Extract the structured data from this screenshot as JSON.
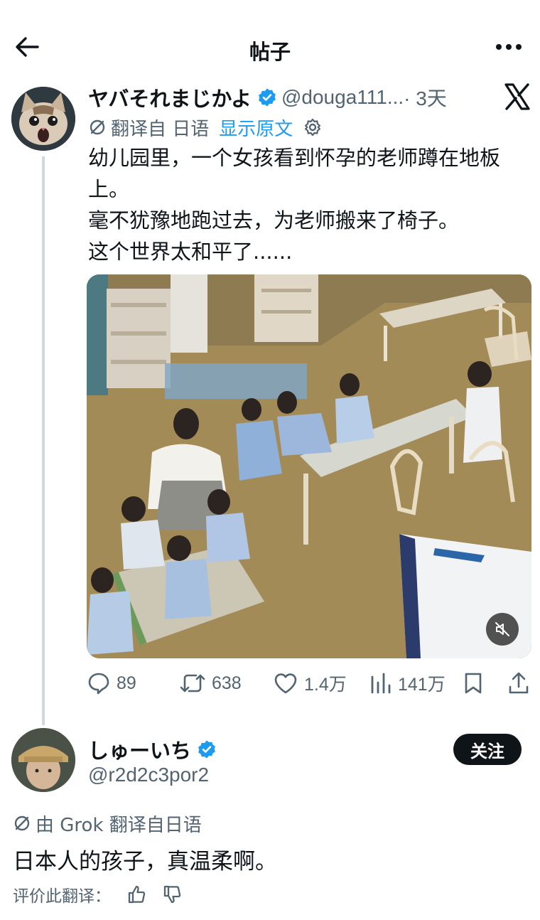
{
  "header": {
    "title": "帖子",
    "back_icon": "arrow-left-icon",
    "more_icon": "more-horizontal-icon"
  },
  "post": {
    "author_name": "ヤバそれまじかよ",
    "handle": "@douga111...",
    "time": "· 3天",
    "translate": {
      "label": "翻译自 日语",
      "show_original": "显示原文"
    },
    "text_lines": [
      "幼儿园里，一个女孩看到怀孕的老师蹲在地板",
      "上。",
      "毫不犹豫地跑过去，为老师搬来了椅子。",
      "这个世界太和平了......"
    ],
    "stats": {
      "replies": "89",
      "reposts": "638",
      "likes": "1.4万",
      "views": "141万"
    }
  },
  "reply": {
    "author_name": "しゅーいち",
    "handle": "@r2d2c3por2",
    "follow_label": "关注",
    "grok_label": "由 Grok 翻译自日语",
    "text": "日本人的孩子，真温柔啊。",
    "rate_label": "评价此翻译："
  },
  "colors": {
    "accent": "#1d9bf0",
    "text": "#0f1419",
    "muted": "#536471",
    "line": "#cfd9de"
  }
}
